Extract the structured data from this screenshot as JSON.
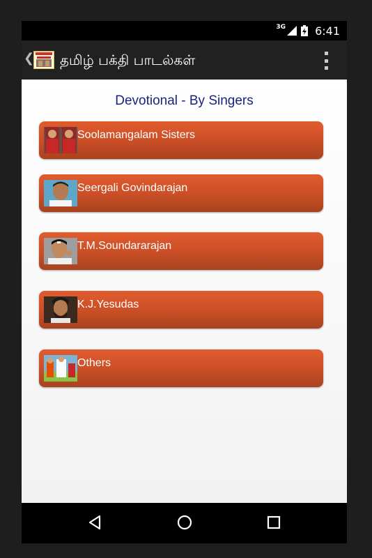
{
  "status_bar": {
    "network": "3G",
    "time": "6:41"
  },
  "action_bar": {
    "title": "தமிழ் பக்தி பாடல்கள்"
  },
  "main": {
    "heading": "Devotional - By Singers",
    "items": [
      {
        "label": "Soolamangalam Sisters"
      },
      {
        "label": "Seergali Govindarajan"
      },
      {
        "label": "T.M.Soundararajan"
      },
      {
        "label": "K.J.Yesudas"
      },
      {
        "label": "Others"
      }
    ]
  },
  "colors": {
    "item_bg": "#cc4f27",
    "heading": "#1a237e",
    "action_bar": "#212121"
  }
}
